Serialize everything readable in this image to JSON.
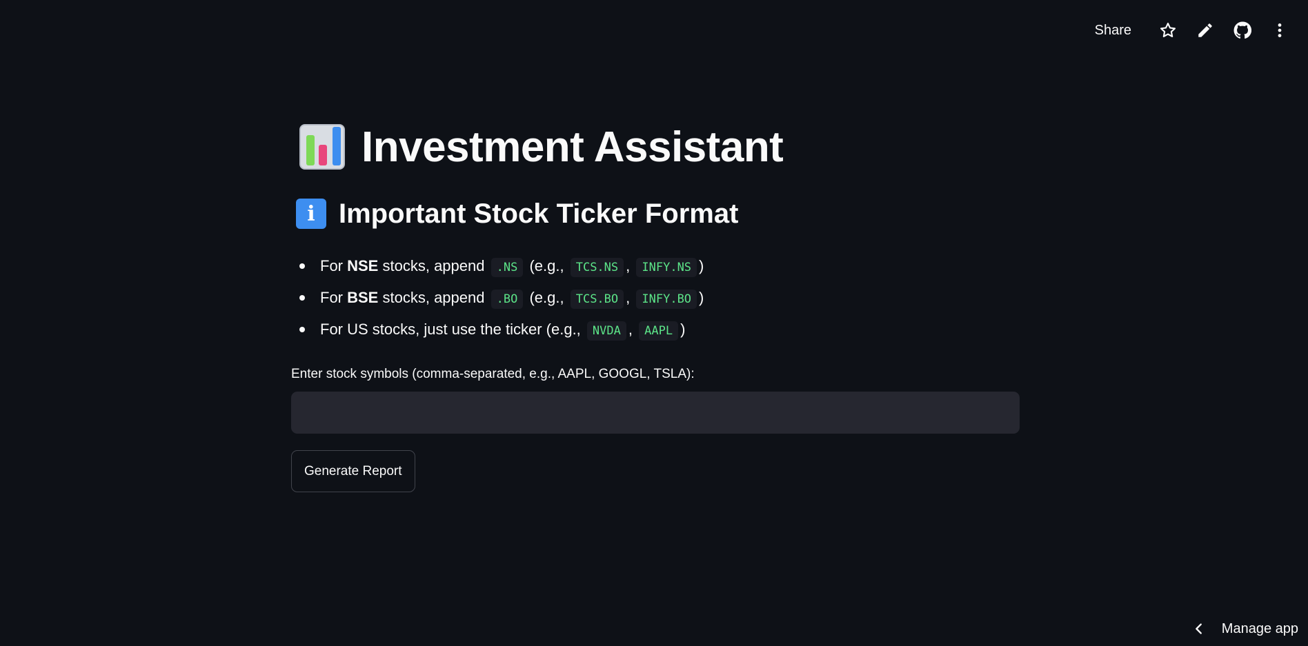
{
  "topbar": {
    "share_label": "Share",
    "icons": [
      "star-icon",
      "pencil-icon",
      "github-icon",
      "more-vertical-icon"
    ]
  },
  "main": {
    "title_emoji": "bar-chart-emoji",
    "title": "Investment Assistant",
    "subtitle_emoji": "info-emoji",
    "subtitle": "Important Stock Ticker Format",
    "bullets": [
      {
        "for": "For",
        "exchange": "NSE",
        "text": "stocks, append",
        "suffix": ".NS",
        "eg_open": "(e.g.,",
        "ex1": "TCS.NS",
        "sep": ",",
        "ex2": "INFY.NS",
        "close": ")"
      },
      {
        "for": "For",
        "exchange": "BSE",
        "text": "stocks, append",
        "suffix": ".BO",
        "eg_open": "(e.g.,",
        "ex1": "TCS.BO",
        "sep": ",",
        "ex2": "INFY.BO",
        "close": ")"
      },
      {
        "text": "For US stocks, just use the ticker (e.g.,",
        "ex1": "NVDA",
        "sep": ",",
        "ex2": "AAPL",
        "close": ")"
      }
    ],
    "input_label": "Enter stock symbols (comma-separated, e.g., AAPL, GOOGL, TSLA):",
    "input_value": "",
    "button_label": "Generate Report"
  },
  "footer": {
    "manage_label": "Manage app"
  },
  "colors": {
    "background": "#0e1117",
    "input_bg": "#262730",
    "code_text": "#5ce488",
    "text": "#fafafa"
  }
}
